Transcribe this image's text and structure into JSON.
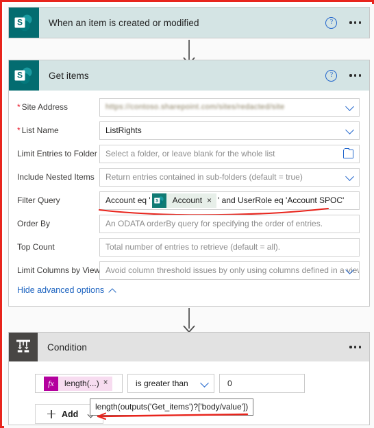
{
  "flow": {
    "trigger_card": {
      "title": "When an item is created or modified",
      "icon": "sharepoint-icon",
      "help_label": "?",
      "menu_label": "•••"
    },
    "action_card": {
      "title": "Get items",
      "icon": "sharepoint-icon",
      "help_label": "?",
      "menu_label": "•••",
      "fields": [
        {
          "label": "Site Address",
          "required": true,
          "value": "",
          "placeholder": "",
          "control": "dropdown",
          "redacted": true,
          "redacted_text": "https://contoso.sharepoint.com/sites/redacted/site"
        },
        {
          "label": "List Name",
          "required": true,
          "value": "ListRights",
          "placeholder": "",
          "control": "dropdown",
          "redacted": false
        },
        {
          "label": "Limit Entries to Folder",
          "required": false,
          "value": "",
          "placeholder": "Select a folder, or leave blank for the whole list",
          "control": "folder-picker",
          "redacted": false
        },
        {
          "label": "Include Nested Items",
          "required": false,
          "value": "",
          "placeholder": "Return entries contained in sub-folders (default = true)",
          "control": "dropdown",
          "redacted": false
        },
        {
          "label": "Order By",
          "required": false,
          "value": "",
          "placeholder": "An ODATA orderBy query for specifying the order of entries.",
          "control": "text",
          "redacted": false
        },
        {
          "label": "Top Count",
          "required": false,
          "value": "",
          "placeholder": "Total number of entries to retrieve (default = all).",
          "control": "text",
          "redacted": false
        },
        {
          "label": "Limit Columns by View",
          "required": false,
          "value": "",
          "placeholder": "Avoid column threshold issues by only using columns defined in a view",
          "control": "dropdown",
          "redacted": false
        }
      ],
      "filter_query": {
        "label": "Filter Query",
        "prefix_text": "Account eq '",
        "token": {
          "label": "Account",
          "icon": "sharepoint-icon",
          "remove_label": "×"
        },
        "suffix_text": "' and UserRole eq 'Account SPOC'",
        "annotated": true
      },
      "advanced_options": {
        "label": "Hide advanced options",
        "icon": "chevron-up-icon"
      }
    },
    "condition_card": {
      "title": "Condition",
      "icon": "condition-icon",
      "menu_label": "•••",
      "expression_chip": {
        "icon_label": "fx",
        "label": "length(...)",
        "remove_label": "×"
      },
      "operator": "is greater than",
      "operator_icon": "chevron-down-icon",
      "value": "0",
      "add_button": {
        "label": "Add",
        "plus_icon": "plus-icon",
        "caret_icon": "chevron-down-icon"
      },
      "tooltip": "length(outputs('Get_items')?['body/value'])",
      "tooltip_annotated": true
    },
    "connectors": [
      {
        "name": "connector-trigger-to-getitems"
      },
      {
        "name": "connector-getitems-to-condition"
      }
    ]
  },
  "colors": {
    "annotation_red": "#e8241c",
    "sharepoint_teal": "#036c70",
    "card_header_blue": "#d4e4e4",
    "condition_header_gray": "#e2e2e2",
    "condition_icon_gray": "#484644",
    "link_blue": "#1f65c1",
    "expression_magenta": "#b4009e",
    "required_red": "#e81123"
  }
}
